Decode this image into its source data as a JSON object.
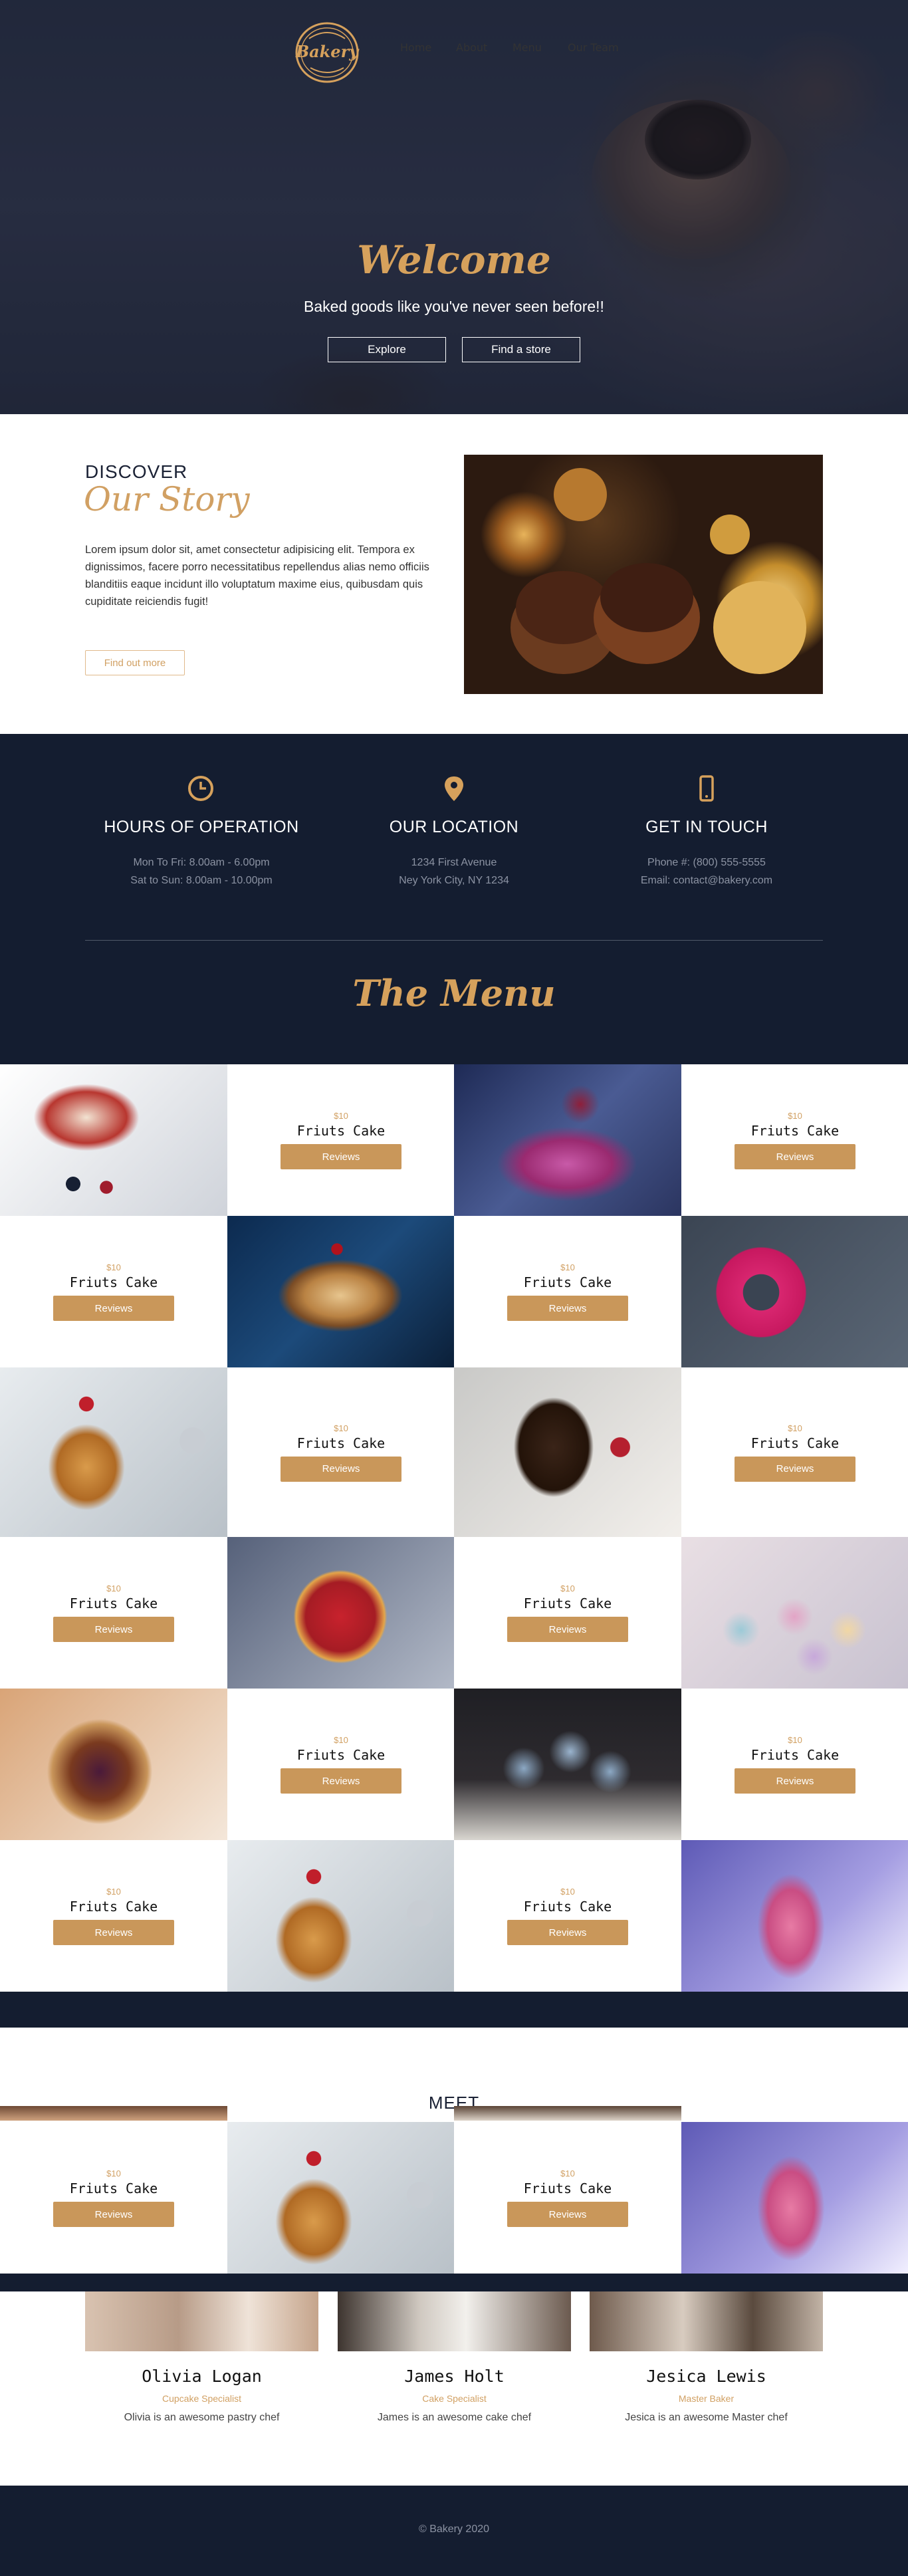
{
  "brand": {
    "logo_text": "Bakery",
    "accent": "#d1a063",
    "dark": "#141d30"
  },
  "nav": {
    "items": [
      "Home",
      "About",
      "Menu",
      "Our Team"
    ]
  },
  "hero": {
    "title": "Welcome",
    "tagline": "Baked goods like you've never seen before!!",
    "explore_label": "Explore",
    "store_label": "Find a store"
  },
  "story": {
    "eyebrow": "DISCOVER",
    "title": "Our Story",
    "text": "Lorem ipsum dolor sit, amet consectetur adipisicing elit. Tempora ex dignissimos, facere porro necessitatibus repellendus alias nemo officiis blanditiis eaque incidunt illo voluptatum maxime eius, quibusdam quis cupiditate reiciendis fugit!",
    "button_label": "Find out more"
  },
  "info": [
    {
      "icon": "clock-icon",
      "heading": "HOURS OF OPERATION",
      "line1": "Mon To Fri: 8.00am - 6.00pm",
      "line2": "Sat to Sun: 8.00am - 10.00pm"
    },
    {
      "icon": "map-pin-icon",
      "heading": "OUR LOCATION",
      "line1": "1234 First Avenue",
      "line2": "Ney York City, NY 1234"
    },
    {
      "icon": "phone-icon",
      "heading": "GET IN TOUCH",
      "line1": "Phone #: (800) 555-5555",
      "line2": "Email: contact@bakery.com"
    }
  ],
  "menu": {
    "title": "The Menu",
    "item": {
      "price": "$10",
      "name": "Friuts Cake",
      "button_label": "Reviews"
    },
    "photos": [
      "cheesecake-slice",
      "berry-cheesecake-bar",
      "layered-cake",
      "pink-donut",
      "pancake-stack",
      "brownie-stack",
      "fruit-tart",
      "macarons",
      "berry-cake",
      "blue-cupcakes",
      "pancake-stack",
      "donut-stack",
      "pancake-stack",
      "donut-stack"
    ]
  },
  "team": {
    "heading_partial": "MEET",
    "members": [
      {
        "name": "Olivia Logan",
        "role": "Cupcake Specialist",
        "desc": "Olivia is an awesome pastry chef"
      },
      {
        "name": "James Holt",
        "role": "Cake Specialist",
        "desc": "James is an awesome cake chef"
      },
      {
        "name": "Jesica Lewis",
        "role": "Master Baker",
        "desc": "Jesica is an awesome Master chef"
      }
    ]
  },
  "footer": {
    "text": "© Bakery 2020"
  }
}
